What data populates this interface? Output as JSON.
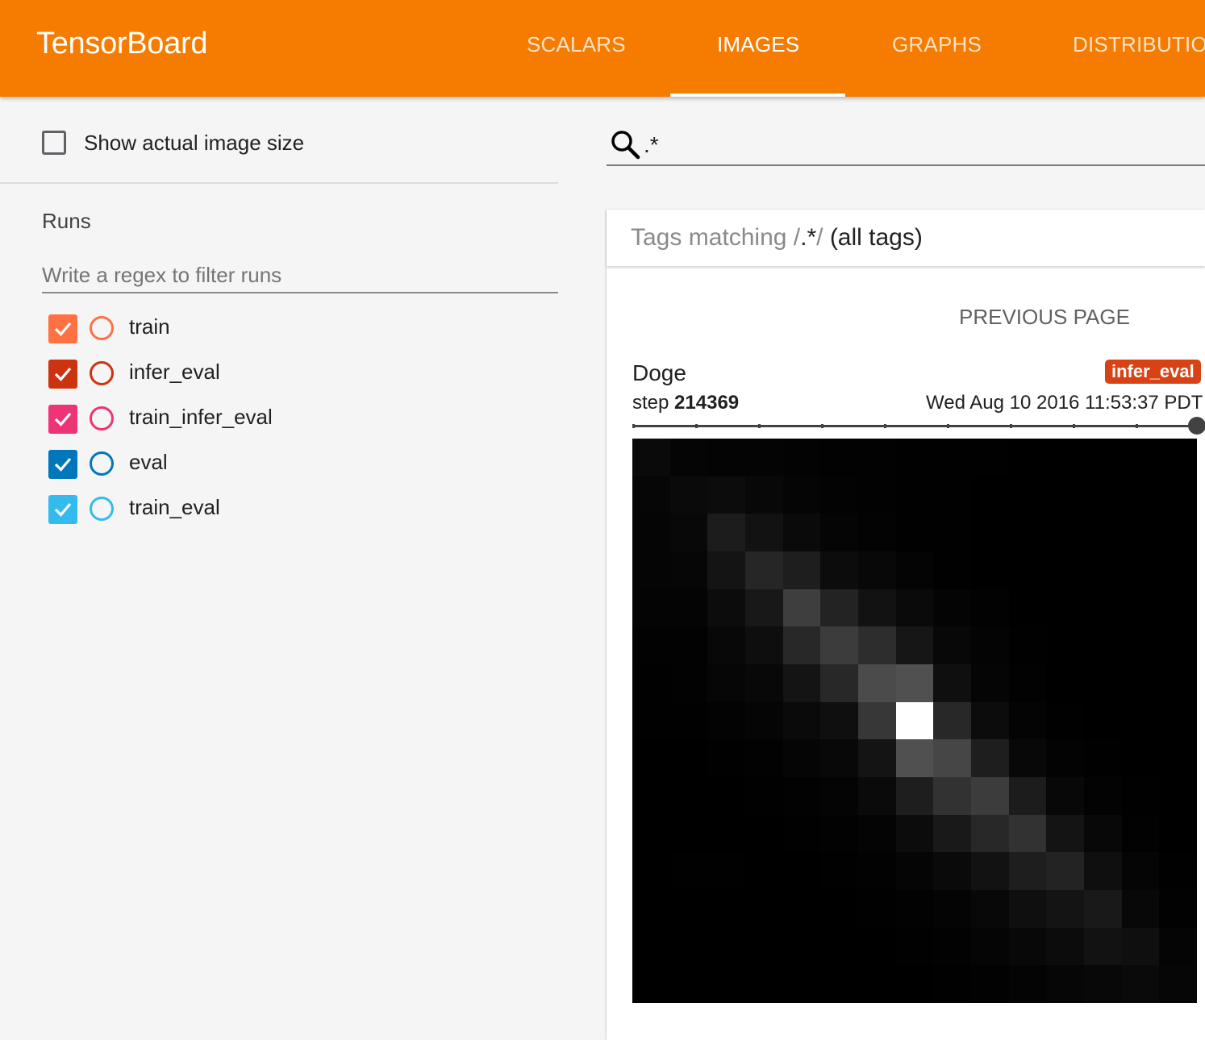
{
  "app": {
    "title": "TensorBoard"
  },
  "tabs": [
    "SCALARS",
    "IMAGES",
    "GRAPHS",
    "DISTRIBUTIO"
  ],
  "sidebar": {
    "show_actual_size_label": "Show actual image size",
    "runs_title": "Runs",
    "filter_placeholder": "Write a regex to filter runs",
    "runs": [
      {
        "label": "train",
        "color": "#ff7043"
      },
      {
        "label": "infer_eval",
        "color": "#cc3311"
      },
      {
        "label": "train_infer_eval",
        "color": "#ee3377"
      },
      {
        "label": "eval",
        "color": "#0077bb"
      },
      {
        "label": "train_eval",
        "color": "#33bbee"
      }
    ]
  },
  "search": {
    "value": ".*",
    "icon": "search-icon"
  },
  "tags_header": {
    "prefix": "Tags matching ",
    "slash_open": "/",
    "regex": ".*",
    "slash_close": "/",
    "suffix": " (all tags)"
  },
  "image_card": {
    "previous_page": "PREVIOUS PAGE",
    "title": "Doge",
    "run_badge": "infer_eval",
    "step_label": "step",
    "step": "214369",
    "timestamp": "Wed Aug 10 2016 11:53:37 PDT",
    "badge_color": "#d84315",
    "step_slider_value": 1.0,
    "pixels": [
      [
        10,
        5,
        4,
        4,
        3,
        2,
        2,
        1,
        1,
        1,
        0,
        0,
        0,
        0,
        0
      ],
      [
        6,
        10,
        12,
        8,
        5,
        3,
        2,
        1,
        1,
        0,
        0,
        0,
        0,
        0,
        0
      ],
      [
        5,
        8,
        28,
        18,
        10,
        5,
        3,
        1,
        1,
        0,
        0,
        0,
        0,
        0,
        0
      ],
      [
        5,
        6,
        20,
        38,
        30,
        12,
        8,
        4,
        1,
        0,
        0,
        0,
        0,
        0,
        0
      ],
      [
        4,
        4,
        12,
        24,
        62,
        35,
        18,
        10,
        4,
        2,
        0,
        0,
        0,
        0,
        0
      ],
      [
        2,
        2,
        8,
        14,
        40,
        60,
        45,
        22,
        8,
        4,
        1,
        0,
        0,
        0,
        0
      ],
      [
        1,
        2,
        6,
        8,
        20,
        40,
        75,
        80,
        15,
        5,
        2,
        0,
        0,
        0,
        0
      ],
      [
        1,
        1,
        3,
        5,
        10,
        15,
        55,
        255,
        40,
        12,
        4,
        1,
        0,
        0,
        0
      ],
      [
        0,
        0,
        1,
        2,
        5,
        8,
        20,
        80,
        70,
        30,
        8,
        3,
        1,
        0,
        0
      ],
      [
        0,
        0,
        0,
        1,
        2,
        4,
        10,
        30,
        50,
        60,
        28,
        8,
        3,
        1,
        0
      ],
      [
        0,
        0,
        0,
        0,
        1,
        2,
        4,
        12,
        25,
        40,
        50,
        20,
        8,
        2,
        0
      ],
      [
        0,
        1,
        1,
        0,
        0,
        1,
        2,
        5,
        10,
        18,
        30,
        35,
        15,
        5,
        1
      ],
      [
        0,
        0,
        0,
        0,
        0,
        0,
        1,
        2,
        4,
        8,
        15,
        20,
        25,
        8,
        2
      ],
      [
        0,
        0,
        0,
        0,
        0,
        0,
        0,
        1,
        2,
        5,
        8,
        12,
        18,
        15,
        5
      ],
      [
        0,
        0,
        0,
        0,
        0,
        0,
        0,
        0,
        1,
        2,
        4,
        6,
        8,
        10,
        6
      ]
    ]
  }
}
